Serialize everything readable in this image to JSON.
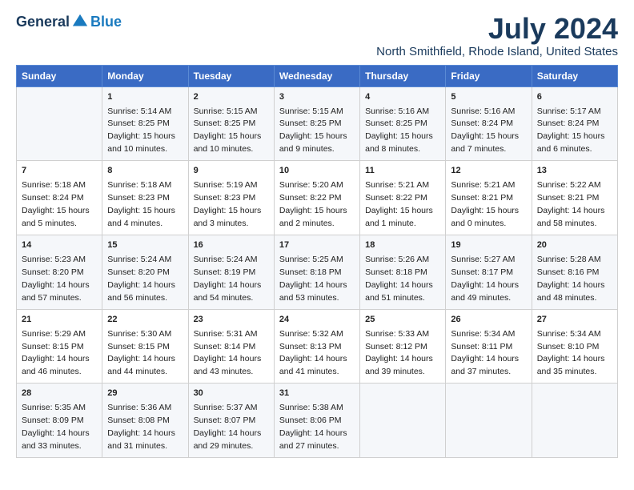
{
  "logo": {
    "general": "General",
    "blue": "Blue"
  },
  "header": {
    "month": "July 2024",
    "location": "North Smithfield, Rhode Island, United States"
  },
  "days_of_week": [
    "Sunday",
    "Monday",
    "Tuesday",
    "Wednesday",
    "Thursday",
    "Friday",
    "Saturday"
  ],
  "weeks": [
    [
      {
        "day": "",
        "info": ""
      },
      {
        "day": "1",
        "info": "Sunrise: 5:14 AM\nSunset: 8:25 PM\nDaylight: 15 hours\nand 10 minutes."
      },
      {
        "day": "2",
        "info": "Sunrise: 5:15 AM\nSunset: 8:25 PM\nDaylight: 15 hours\nand 10 minutes."
      },
      {
        "day": "3",
        "info": "Sunrise: 5:15 AM\nSunset: 8:25 PM\nDaylight: 15 hours\nand 9 minutes."
      },
      {
        "day": "4",
        "info": "Sunrise: 5:16 AM\nSunset: 8:25 PM\nDaylight: 15 hours\nand 8 minutes."
      },
      {
        "day": "5",
        "info": "Sunrise: 5:16 AM\nSunset: 8:24 PM\nDaylight: 15 hours\nand 7 minutes."
      },
      {
        "day": "6",
        "info": "Sunrise: 5:17 AM\nSunset: 8:24 PM\nDaylight: 15 hours\nand 6 minutes."
      }
    ],
    [
      {
        "day": "7",
        "info": "Sunrise: 5:18 AM\nSunset: 8:24 PM\nDaylight: 15 hours\nand 5 minutes."
      },
      {
        "day": "8",
        "info": "Sunrise: 5:18 AM\nSunset: 8:23 PM\nDaylight: 15 hours\nand 4 minutes."
      },
      {
        "day": "9",
        "info": "Sunrise: 5:19 AM\nSunset: 8:23 PM\nDaylight: 15 hours\nand 3 minutes."
      },
      {
        "day": "10",
        "info": "Sunrise: 5:20 AM\nSunset: 8:22 PM\nDaylight: 15 hours\nand 2 minutes."
      },
      {
        "day": "11",
        "info": "Sunrise: 5:21 AM\nSunset: 8:22 PM\nDaylight: 15 hours\nand 1 minute."
      },
      {
        "day": "12",
        "info": "Sunrise: 5:21 AM\nSunset: 8:21 PM\nDaylight: 15 hours\nand 0 minutes."
      },
      {
        "day": "13",
        "info": "Sunrise: 5:22 AM\nSunset: 8:21 PM\nDaylight: 14 hours\nand 58 minutes."
      }
    ],
    [
      {
        "day": "14",
        "info": "Sunrise: 5:23 AM\nSunset: 8:20 PM\nDaylight: 14 hours\nand 57 minutes."
      },
      {
        "day": "15",
        "info": "Sunrise: 5:24 AM\nSunset: 8:20 PM\nDaylight: 14 hours\nand 56 minutes."
      },
      {
        "day": "16",
        "info": "Sunrise: 5:24 AM\nSunset: 8:19 PM\nDaylight: 14 hours\nand 54 minutes."
      },
      {
        "day": "17",
        "info": "Sunrise: 5:25 AM\nSunset: 8:18 PM\nDaylight: 14 hours\nand 53 minutes."
      },
      {
        "day": "18",
        "info": "Sunrise: 5:26 AM\nSunset: 8:18 PM\nDaylight: 14 hours\nand 51 minutes."
      },
      {
        "day": "19",
        "info": "Sunrise: 5:27 AM\nSunset: 8:17 PM\nDaylight: 14 hours\nand 49 minutes."
      },
      {
        "day": "20",
        "info": "Sunrise: 5:28 AM\nSunset: 8:16 PM\nDaylight: 14 hours\nand 48 minutes."
      }
    ],
    [
      {
        "day": "21",
        "info": "Sunrise: 5:29 AM\nSunset: 8:15 PM\nDaylight: 14 hours\nand 46 minutes."
      },
      {
        "day": "22",
        "info": "Sunrise: 5:30 AM\nSunset: 8:15 PM\nDaylight: 14 hours\nand 44 minutes."
      },
      {
        "day": "23",
        "info": "Sunrise: 5:31 AM\nSunset: 8:14 PM\nDaylight: 14 hours\nand 43 minutes."
      },
      {
        "day": "24",
        "info": "Sunrise: 5:32 AM\nSunset: 8:13 PM\nDaylight: 14 hours\nand 41 minutes."
      },
      {
        "day": "25",
        "info": "Sunrise: 5:33 AM\nSunset: 8:12 PM\nDaylight: 14 hours\nand 39 minutes."
      },
      {
        "day": "26",
        "info": "Sunrise: 5:34 AM\nSunset: 8:11 PM\nDaylight: 14 hours\nand 37 minutes."
      },
      {
        "day": "27",
        "info": "Sunrise: 5:34 AM\nSunset: 8:10 PM\nDaylight: 14 hours\nand 35 minutes."
      }
    ],
    [
      {
        "day": "28",
        "info": "Sunrise: 5:35 AM\nSunset: 8:09 PM\nDaylight: 14 hours\nand 33 minutes."
      },
      {
        "day": "29",
        "info": "Sunrise: 5:36 AM\nSunset: 8:08 PM\nDaylight: 14 hours\nand 31 minutes."
      },
      {
        "day": "30",
        "info": "Sunrise: 5:37 AM\nSunset: 8:07 PM\nDaylight: 14 hours\nand 29 minutes."
      },
      {
        "day": "31",
        "info": "Sunrise: 5:38 AM\nSunset: 8:06 PM\nDaylight: 14 hours\nand 27 minutes."
      },
      {
        "day": "",
        "info": ""
      },
      {
        "day": "",
        "info": ""
      },
      {
        "day": "",
        "info": ""
      }
    ]
  ]
}
